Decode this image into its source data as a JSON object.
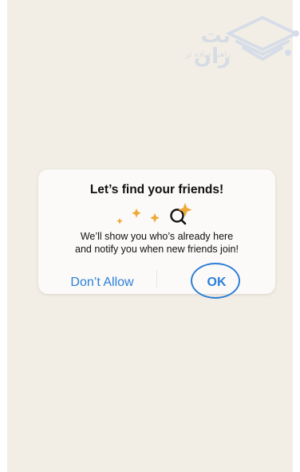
{
  "watermark": {
    "title": "نت ران",
    "subtitle": "راهی ساده تر"
  },
  "dialog": {
    "title": "Let’s find your friends!",
    "message_line1": "We’ll show you who’s already here",
    "message_line2": "and notify you when new friends join!",
    "deny_label": "Don’t Allow",
    "ok_label": "OK",
    "illustration_icons": [
      "sparkle-icon",
      "sparkle-icon",
      "sparkle-icon",
      "magnifier-sparkle-icon"
    ]
  },
  "colors": {
    "background": "#f2eee5",
    "dialog": "#fbfaf8",
    "accent": "#2b7fd9",
    "highlight": "#2f7fd6",
    "sparkle": "#f0a937"
  }
}
